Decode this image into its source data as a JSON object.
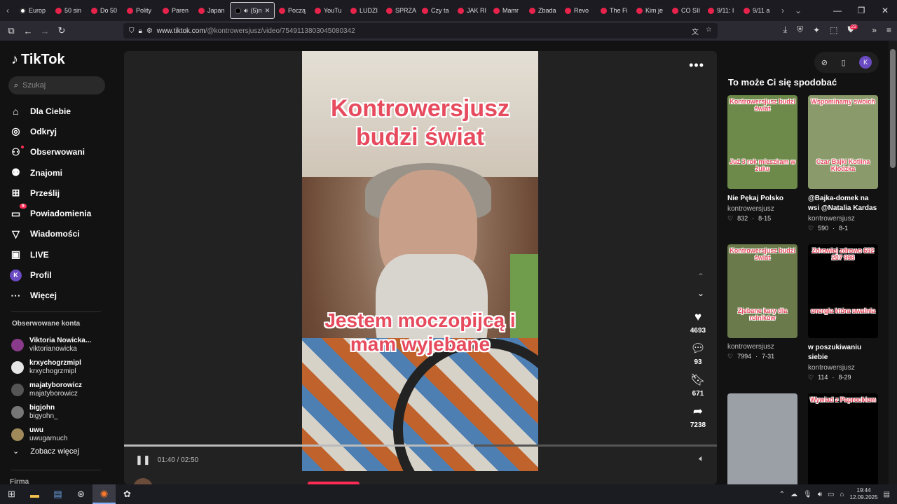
{
  "browser": {
    "tabs": [
      {
        "label": "Europ",
        "icon": "globe"
      },
      {
        "label": "50 sin",
        "icon": "youtube"
      },
      {
        "label": "Do 50",
        "icon": "youtube"
      },
      {
        "label": "Polity",
        "icon": "youtube"
      },
      {
        "label": "Paren",
        "icon": "youtube"
      },
      {
        "label": "Japan",
        "icon": "youtube"
      },
      {
        "label": "(5)n",
        "icon": "tiktok",
        "active": true
      },
      {
        "label": "Począ",
        "icon": "youtube"
      },
      {
        "label": "YouTu",
        "icon": "youtube"
      },
      {
        "label": "LUDZI",
        "icon": "youtube"
      },
      {
        "label": "SPRZA",
        "icon": "youtube"
      },
      {
        "label": "Czy ta",
        "icon": "youtube"
      },
      {
        "label": "JAK RI",
        "icon": "youtube"
      },
      {
        "label": "Mamr",
        "icon": "youtube"
      },
      {
        "label": "Zbada",
        "icon": "youtube"
      },
      {
        "label": "Revo",
        "icon": "youtube"
      },
      {
        "label": "The Fi",
        "icon": "youtube"
      },
      {
        "label": "Kim je",
        "icon": "youtube"
      },
      {
        "label": "CO SII",
        "icon": "youtube"
      },
      {
        "label": "9/11: I",
        "icon": "youtube"
      },
      {
        "label": "9/11 a",
        "icon": "youtube"
      }
    ],
    "url_host": "www.tiktok.com",
    "url_path": "/@kontrowersjusz/video/7549113803045080342",
    "extension_badge": "22"
  },
  "sidebar": {
    "logo": "TikTok",
    "search_placeholder": "Szukaj",
    "menu": [
      {
        "label": "Dla Ciebie",
        "icon": "home-icon",
        "glyph": "⌂"
      },
      {
        "label": "Odkryj",
        "icon": "compass-icon",
        "glyph": "◎"
      },
      {
        "label": "Obserwowani",
        "icon": "following-icon",
        "glyph": "⚇",
        "dot": true
      },
      {
        "label": "Znajomi",
        "icon": "friends-icon",
        "glyph": "⚉"
      },
      {
        "label": "Prześlij",
        "icon": "upload-icon",
        "glyph": "⊞"
      },
      {
        "label": "Powiadomienia",
        "icon": "inbox-icon",
        "glyph": "▭",
        "count": "5"
      },
      {
        "label": "Wiadomości",
        "icon": "messages-icon",
        "glyph": "▽"
      },
      {
        "label": "LIVE",
        "icon": "live-icon",
        "glyph": "▣"
      },
      {
        "label": "Profil",
        "icon": "profile-icon",
        "glyph": "K"
      },
      {
        "label": "Więcej",
        "icon": "more-icon",
        "glyph": "···"
      }
    ],
    "following_title": "Obserwowane konta",
    "following": [
      {
        "name": "Viktoria Nowicka...",
        "handle": "viktorianowicka"
      },
      {
        "name": "krxychogrzmipl",
        "handle": "krxychogrzmipl"
      },
      {
        "name": "majatyborowicz",
        "handle": "majatyborowicz"
      },
      {
        "name": "bigjohn",
        "handle": "bigyohn_"
      },
      {
        "name": "uwu",
        "handle": "uwugarnuch"
      }
    ],
    "see_more": "Zobacz więcej",
    "company": "Firma"
  },
  "video": {
    "caption_top": "Kontrowersjusz budzi świat",
    "caption_mid": "Jestem moczopijcą i mam wyjebane",
    "likes": "4693",
    "comments": "93",
    "saves": "671",
    "shares": "7238",
    "time_current": "01:40",
    "time_total": "02:50",
    "progress": 0.59,
    "author": "kontrowersjusz"
  },
  "recommendations": {
    "title": "To może Ci się spodobać",
    "items": [
      {
        "caption_top": "Kontrowersjusz budzi świat",
        "caption_bottom": "Już 3 rok mieszkam w żuku",
        "label": "Nie Pękaj Polsko",
        "author": "kontrowersjusz",
        "likes": "832",
        "date": "8-15",
        "bg": "#6d8a4a"
      },
      {
        "caption_top": "Wspominamy swoich",
        "caption_bottom": "Czar Bajki Kotlina Kłodzka",
        "label": "@Bajka-domek na wsi @Natalia Kardas",
        "author": "kontrowersjusz",
        "likes": "590",
        "date": "8-1",
        "bg": "#8a9a6a"
      },
      {
        "caption_top": "Kontrowersjusz budzi świat",
        "caption_bottom": "Zjebane kary dla rolników",
        "label": "",
        "author": "kontrowersjusz",
        "likes": "7994",
        "date": "7-31",
        "bg": "#6a7a4a"
      },
      {
        "caption_top": "Zdrowiej zdrowo 692 207 998",
        "caption_bottom": "energia która uwalnia",
        "label": "w poszukiwaniu siebie",
        "author": "kontrowersjusz",
        "likes": "114",
        "date": "8-29",
        "bg": "#000000"
      },
      {
        "caption_top": "",
        "caption_bottom": "",
        "label": "",
        "author": "",
        "likes": "",
        "date": "",
        "bg": "#9aa0a6"
      },
      {
        "caption_top": "Wywiad z Paprockiem",
        "caption_bottom": "",
        "label": "",
        "author": "",
        "likes": "",
        "date": "",
        "bg": "#000000"
      }
    ]
  },
  "taskbar": {
    "time": "19:44",
    "date": "12.09.2025"
  }
}
